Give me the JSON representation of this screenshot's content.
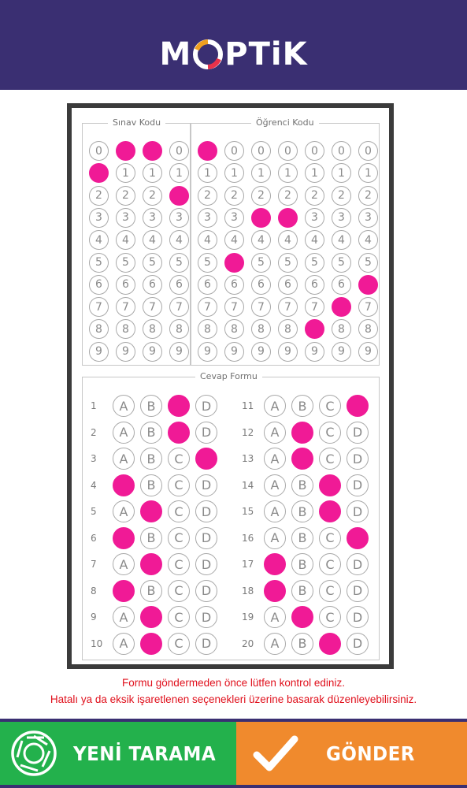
{
  "header": {
    "logo_text_left": "M",
    "logo_text_right": "PTiK",
    "logo_icon": "check-circle-icon"
  },
  "sheet": {
    "exam_code_label": "Sınav Kodu",
    "student_code_label": "Öğrenci Kodu",
    "answer_form_label": "Cevap Formu",
    "digits": [
      "0",
      "1",
      "2",
      "3",
      "4",
      "5",
      "6",
      "7",
      "8",
      "9"
    ],
    "exam_code_selected": [
      1,
      0,
      0,
      2
    ],
    "student_code_selected": [
      0,
      5,
      3,
      3,
      8,
      7,
      6
    ],
    "options": [
      "A",
      "B",
      "C",
      "D"
    ],
    "answers": [
      {
        "q": "1",
        "selected": "C"
      },
      {
        "q": "2",
        "selected": "C"
      },
      {
        "q": "3",
        "selected": "D"
      },
      {
        "q": "4",
        "selected": "A"
      },
      {
        "q": "5",
        "selected": "B"
      },
      {
        "q": "6",
        "selected": "A"
      },
      {
        "q": "7",
        "selected": "B"
      },
      {
        "q": "8",
        "selected": "A"
      },
      {
        "q": "9",
        "selected": "B"
      },
      {
        "q": "10",
        "selected": "B"
      },
      {
        "q": "11",
        "selected": "D"
      },
      {
        "q": "12",
        "selected": "B"
      },
      {
        "q": "13",
        "selected": "B"
      },
      {
        "q": "14",
        "selected": "C"
      },
      {
        "q": "15",
        "selected": "C"
      },
      {
        "q": "16",
        "selected": "D"
      },
      {
        "q": "17",
        "selected": "A"
      },
      {
        "q": "18",
        "selected": "A"
      },
      {
        "q": "19",
        "selected": "B"
      },
      {
        "q": "20",
        "selected": "C"
      }
    ]
  },
  "notice": {
    "line1": "Formu göndermeden önce lütfen kontrol ediniz.",
    "line2": "Hatalı ya da eksik işaretlenen seçenekleri üzerine basarak düzenleyebilirsiniz."
  },
  "buttons": {
    "new_scan_label": "YENİ TARAMA",
    "new_scan_icon": "camera-shutter-icon",
    "send_label": "GÖNDER",
    "send_icon": "checkmark-icon"
  },
  "colors": {
    "header_bg": "#3a2f72",
    "filled_bubble": "#f01a96",
    "notice_text": "#e0101c",
    "new_scan_bg": "#23b14c",
    "send_bg": "#f08a2d"
  }
}
